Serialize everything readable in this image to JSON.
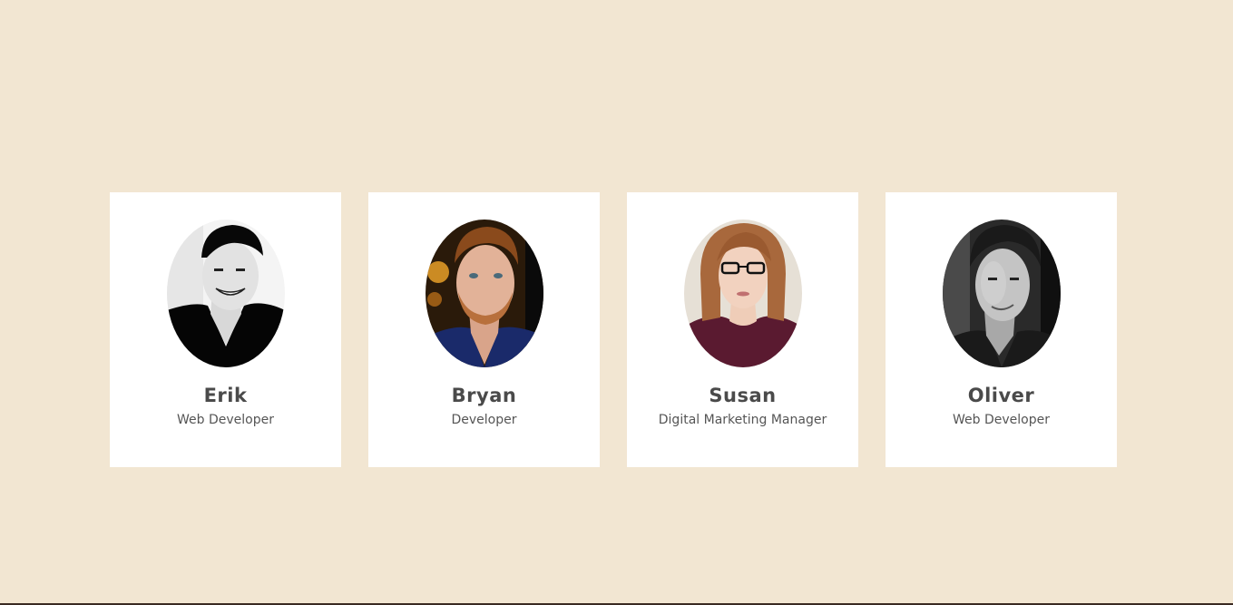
{
  "team": [
    {
      "name": "Erik",
      "role": "Web Developer",
      "avatar_icon": "person-photo-icon",
      "tone": "bw-light"
    },
    {
      "name": "Bryan",
      "role": "Developer",
      "avatar_icon": "person-photo-icon",
      "tone": "color-warm"
    },
    {
      "name": "Susan",
      "role": "Digital Marketing Manager",
      "avatar_icon": "person-photo-icon",
      "tone": "color-light"
    },
    {
      "name": "Oliver",
      "role": "Web Developer",
      "avatar_icon": "person-photo-icon",
      "tone": "bw-dark"
    }
  ],
  "colors": {
    "background": "#f2e6d2",
    "card": "#ffffff",
    "name_text": "#4a4a4a",
    "role_text": "#555555"
  }
}
